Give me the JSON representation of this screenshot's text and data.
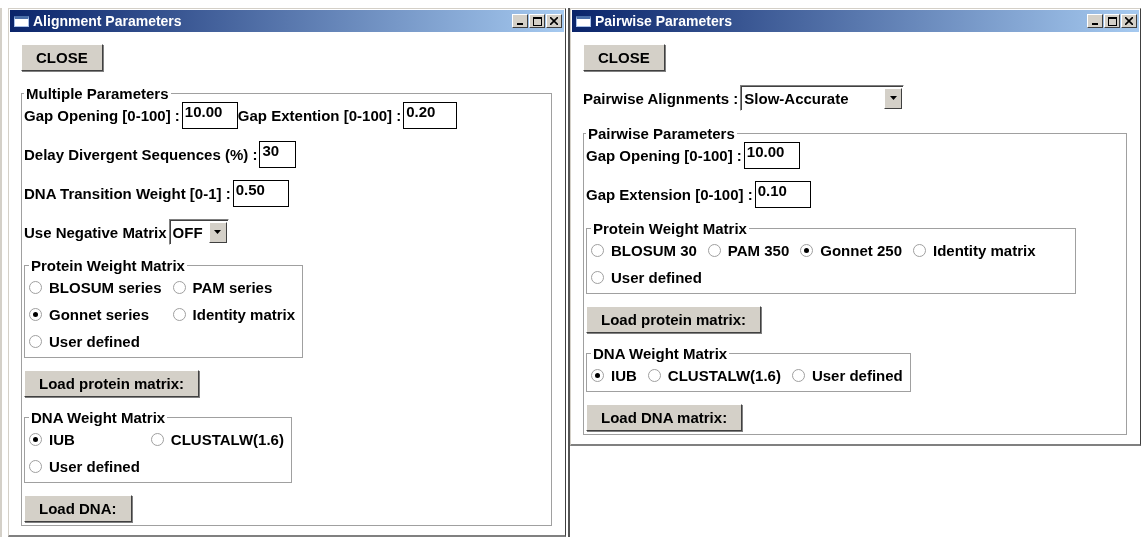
{
  "windows": [
    {
      "title": "Alignment Parameters",
      "close_button": "CLOSE",
      "items": [
        {
          "kind": "fieldset",
          "title": "Multiple Parameters",
          "items": [
            {
              "kind": "fields",
              "fields": [
                {
                  "label": "Gap Opening [0-100] :",
                  "value": "10.00"
                },
                {
                  "label": "Gap Extention [0-100] :",
                  "value": "0.20"
                }
              ]
            },
            {
              "kind": "fields",
              "fields": [
                {
                  "label": "Delay Divergent Sequences (%) :",
                  "value": "30"
                }
              ]
            },
            {
              "kind": "fields",
              "fields": [
                {
                  "label": "DNA Transition Weight [0-1] :",
                  "value": "0.50"
                }
              ]
            },
            {
              "kind": "select",
              "label": "Use Negative Matrix",
              "value": "OFF"
            },
            {
              "kind": "radio_grid",
              "title": "Protein Weight Matrix",
              "options": [
                {
                  "label": "BLOSUM series",
                  "selected": false
                },
                {
                  "label": "PAM series",
                  "selected": false
                },
                {
                  "label": "Gonnet series",
                  "selected": true
                },
                {
                  "label": "Identity matrix",
                  "selected": false
                },
                {
                  "label": "User defined",
                  "selected": false
                }
              ]
            },
            {
              "kind": "button",
              "label": "Load protein matrix:"
            },
            {
              "kind": "radio_grid",
              "title": "DNA Weight Matrix",
              "options": [
                {
                  "label": "IUB",
                  "selected": true
                },
                {
                  "label": "CLUSTALW(1.6)",
                  "selected": false
                },
                {
                  "label": "User defined",
                  "selected": false
                }
              ]
            },
            {
              "kind": "button",
              "label": "Load DNA:"
            }
          ]
        }
      ]
    },
    {
      "title": "Pairwise Parameters",
      "close_button": "CLOSE",
      "items": [
        {
          "kind": "select",
          "label": "Pairwise Alignments :",
          "value": "Slow-Accurate"
        },
        {
          "kind": "fieldset",
          "title": "Pairwise Parameters",
          "items": [
            {
              "kind": "fields",
              "fields": [
                {
                  "label": "Gap Opening [0-100] :",
                  "value": "10.00"
                }
              ]
            },
            {
              "kind": "fields",
              "fields": [
                {
                  "label": "Gap Extension [0-100] :",
                  "value": "0.10"
                }
              ]
            },
            {
              "kind": "radio_row",
              "title": "Protein Weight Matrix",
              "options": [
                {
                  "label": "BLOSUM 30",
                  "selected": false
                },
                {
                  "label": "PAM 350",
                  "selected": false
                },
                {
                  "label": "Gonnet 250",
                  "selected": true
                },
                {
                  "label": "Identity matrix",
                  "selected": false
                },
                {
                  "label": "User defined",
                  "selected": false
                }
              ]
            },
            {
              "kind": "button",
              "label": "Load protein matrix:"
            },
            {
              "kind": "radio_row",
              "title": "DNA Weight Matrix",
              "options": [
                {
                  "label": "IUB",
                  "selected": true
                },
                {
                  "label": "CLUSTALW(1.6)",
                  "selected": false
                },
                {
                  "label": "User defined",
                  "selected": false
                }
              ]
            },
            {
              "kind": "button",
              "label": "Load DNA matrix:"
            }
          ]
        }
      ]
    }
  ]
}
